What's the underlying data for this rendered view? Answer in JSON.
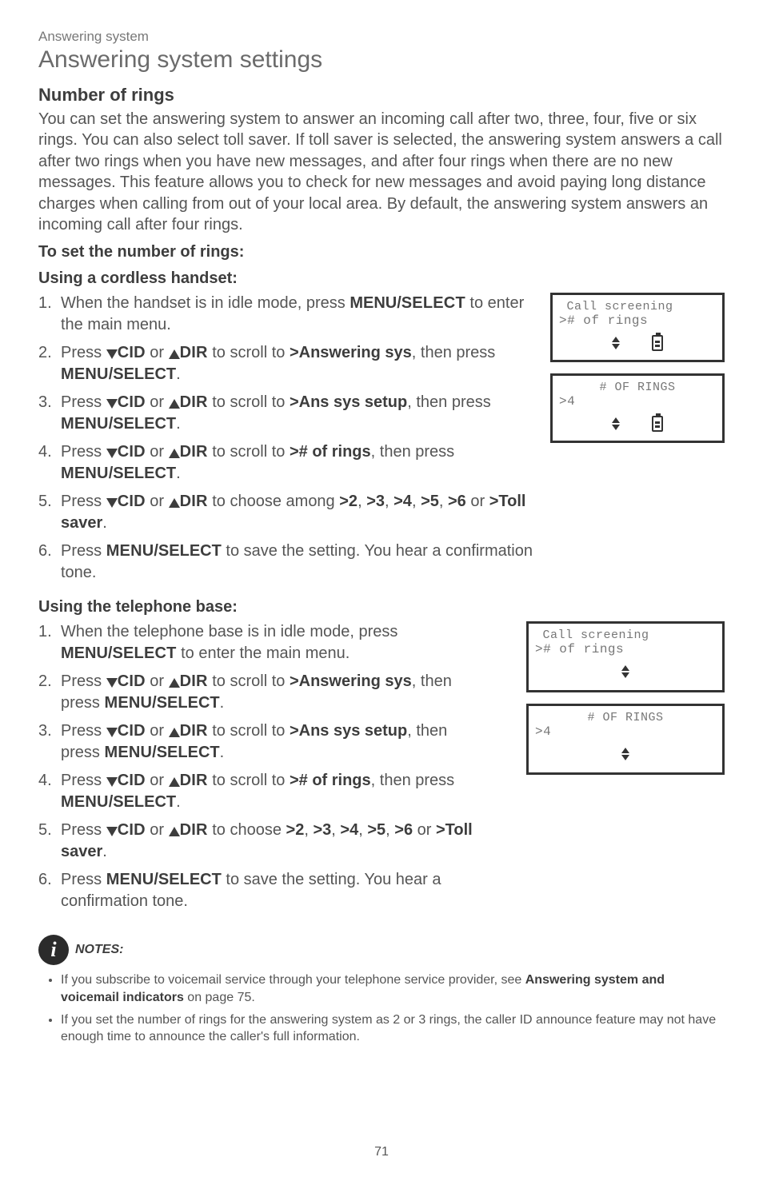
{
  "breadcrumb": "Answering system",
  "section_title": "Answering system settings",
  "heading": "Number of rings",
  "intro": "You can set the answering system to answer an incoming call after two, three, four, five or six rings. You can also select toll saver. If toll saver is selected, the answering system answers a call after two rings when you have new messages, and after four rings when there are no new messages. This feature allows you to check for new messages and avoid paying long distance charges when calling from out of your local area. By default, the answering system answers an incoming call after four rings.",
  "subhead1": "To set the number of rings:",
  "subhead2": "Using a cordless handset:",
  "subhead3": "Using the telephone base:",
  "labels": {
    "cid": "CID",
    "dir": "DIR",
    "menu_select_mixed": "MENU/",
    "select_sc": "SELECT",
    "menu_sc": "MENU",
    "slash_select_b": "/SELECT"
  },
  "targets": {
    "answering_sys": ">Answering sys",
    "ans_sys_setup": ">Ans sys setup",
    "num_rings": "># of rings",
    "opts": {
      "g2": ">2",
      "g3": ">3",
      "g4": ">4",
      "g5": ">5",
      "g6": ">6",
      "toll": ">Toll saver"
    }
  },
  "handset_steps_tail": {
    "s1a": "When the handset is in idle mode, press ",
    "s1b": " to enter the main menu.",
    "press": "Press ",
    "or": " or ",
    "scroll_to": " to scroll to ",
    "then_press": ", then press ",
    "choose_among": " to choose among ",
    "save": " to save the setting. You hear a confirmation tone.",
    "period": "."
  },
  "base_s1": "When the telephone base is in idle mode, press ",
  "base_s1_tail": " to enter the main menu.",
  "choose_plain": " to choose ",
  "lcd1": {
    "line1": " Call screening",
    "line2": "># of rings"
  },
  "lcd2": {
    "title": "# OF RINGS",
    "line2": ">4"
  },
  "lcd3": {
    "line1": " Call screening",
    "line2": "># of rings"
  },
  "lcd4": {
    "title": "# OF RINGS",
    "line2": ">4"
  },
  "notes_label": "NOTES:",
  "notes": [
    {
      "pre": "If you subscribe to voicemail service through your telephone service provider, see ",
      "bold": "Answering system and voicemail indicators",
      "post": " on page 75."
    },
    {
      "pre": "If you set the number of rings for the answering system as 2 or 3 rings, the caller ID announce feature may not have enough time to announce the caller's full information.",
      "bold": "",
      "post": ""
    }
  ],
  "page_ref": "75",
  "page_number": "71"
}
